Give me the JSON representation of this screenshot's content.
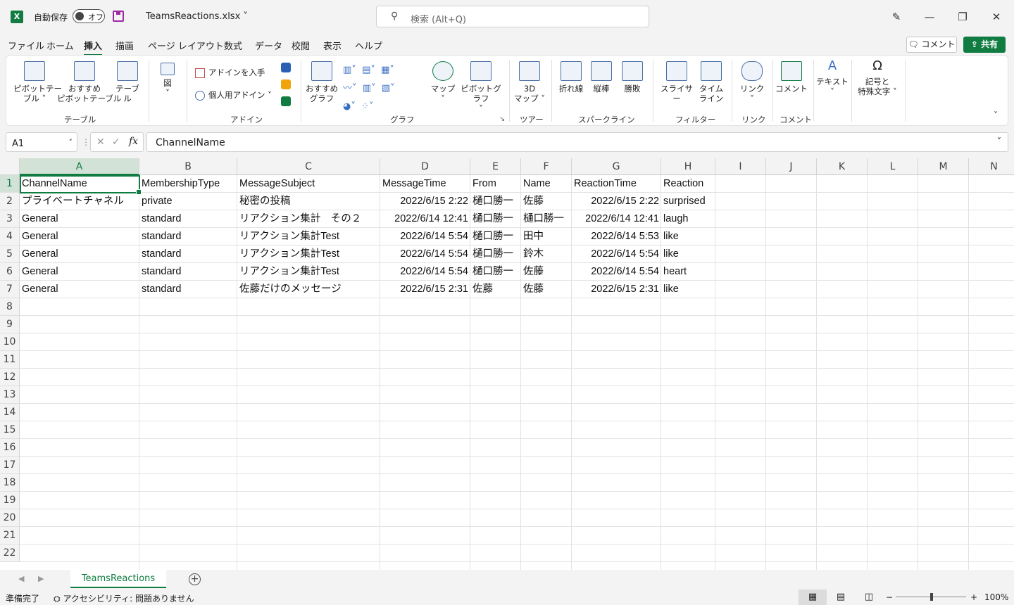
{
  "app": {
    "logo": "X",
    "autosave_label": "自動保存",
    "autosave_state": "オフ",
    "filename": "TeamsReactions.xlsx",
    "search_placeholder": "検索 (Alt+Q)",
    "window_controls": [
      "minimize-icon",
      "restore-icon",
      "close-icon"
    ]
  },
  "menu": {
    "tabs": [
      "ファイル",
      "ホーム",
      "挿入",
      "描画",
      "ページ レイアウト",
      "数式",
      "データ",
      "校閲",
      "表示",
      "ヘルプ"
    ],
    "active_tab": "挿入",
    "comment_label": "コメント",
    "share_label": "共有"
  },
  "ribbon": {
    "pivot_table": "ピボットテー\nブル ˅",
    "recommended_pivot": "おすすめ\nピボットテーブル",
    "table": "テーブル",
    "group_table": "テーブル",
    "figure": "図",
    "get_addins": "アドインを入手",
    "my_addins": "個人用アドイン",
    "group_addins": "アドイン",
    "recommended_charts": "おすすめ\nグラフ",
    "maps": "マップ",
    "pivot_chart": "ピボットグラフ",
    "group_charts": "グラフ",
    "map3d": "3D\nマップ ˅",
    "group_tours": "ツアー",
    "spark_line": "折れ線",
    "spark_column": "縦棒",
    "spark_winloss": "勝敗",
    "group_sparklines": "スパークライン",
    "slicer": "スライサー",
    "timeline": "タイム\nライン",
    "group_filters": "フィルター",
    "link": "リンク",
    "group_links": "リンク",
    "comment": "コメント",
    "group_comments": "コメント",
    "text": "テキスト",
    "symbols": "記号と\n特殊文字 ˅"
  },
  "formula_bar": {
    "name_box": "A1",
    "fx": "fx",
    "content": "ChannelName"
  },
  "grid": {
    "columns": [
      "A",
      "B",
      "C",
      "D",
      "E",
      "F",
      "G",
      "H",
      "I",
      "J",
      "K",
      "L",
      "M",
      "N"
    ],
    "row_numbers": [
      "1",
      "2",
      "3",
      "4",
      "5",
      "6",
      "7",
      "8",
      "9",
      "10",
      "11",
      "12",
      "13",
      "14",
      "15",
      "16",
      "17",
      "18",
      "19",
      "20",
      "21",
      "22"
    ],
    "rows": [
      [
        "ChannelName",
        "MembershipType",
        "MessageSubject",
        "MessageTime",
        "From",
        "Name",
        "ReactionTime",
        "Reaction"
      ],
      [
        "プライベートチャネル",
        "private",
        "秘密の投稿",
        "2022/6/15 2:22",
        "樋口勝一",
        "佐藤",
        "2022/6/15 2:22",
        "surprised"
      ],
      [
        "General",
        "standard",
        "リアクション集計　その２",
        "2022/6/14 12:41",
        "樋口勝一",
        "樋口勝一",
        "2022/6/14 12:41",
        "laugh"
      ],
      [
        "General",
        "standard",
        "リアクション集計Test",
        "2022/6/14 5:54",
        "樋口勝一",
        "田中",
        "2022/6/14 5:53",
        "like"
      ],
      [
        "General",
        "standard",
        "リアクション集計Test",
        "2022/6/14 5:54",
        "樋口勝一",
        "鈴木",
        "2022/6/14 5:54",
        "like"
      ],
      [
        "General",
        "standard",
        "リアクション集計Test",
        "2022/6/14 5:54",
        "樋口勝一",
        "佐藤",
        "2022/6/14 5:54",
        "heart"
      ],
      [
        "General",
        "standard",
        "佐藤だけのメッセージ",
        "2022/6/15 2:31",
        "佐藤",
        "佐藤",
        "2022/6/15 2:31",
        "like"
      ]
    ],
    "selected_cell": "A1"
  },
  "sheets": {
    "tabs": [
      "TeamsReactions"
    ],
    "active": "TeamsReactions"
  },
  "status": {
    "ready": "準備完了",
    "accessibility": "アクセシビリティ: 問題ありません",
    "zoom": "100%"
  }
}
